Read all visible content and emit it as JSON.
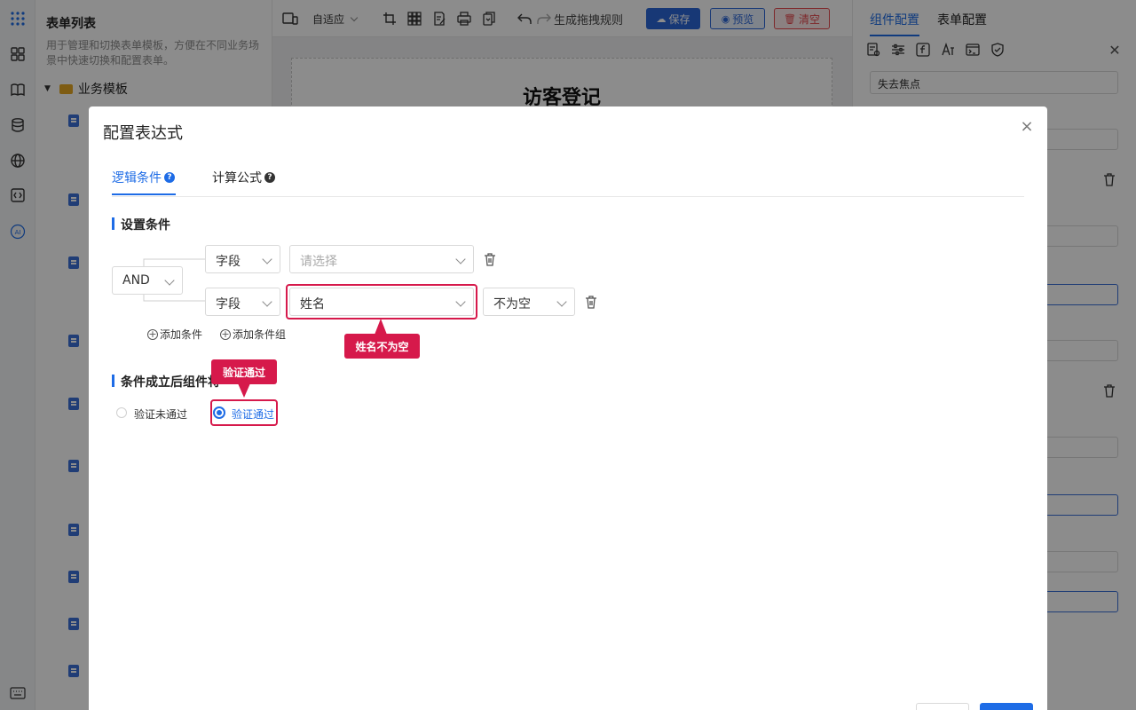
{
  "sidebar_list": {
    "title": "表单列表",
    "description": "用于管理和切换表单模板，方便在不同业务场景中快速切换和配置表单。",
    "folder": "业务模板"
  },
  "toolbar": {
    "fit_label": "自适应",
    "drag_rule_label": "生成拖拽规则",
    "save_label": "保存",
    "preview_label": "预览",
    "clear_label": "清空"
  },
  "canvas": {
    "form_title": "访客登记"
  },
  "right_panel": {
    "tab_component": "组件配置",
    "tab_form": "表单配置",
    "trigger_value": "失去焦点"
  },
  "modal": {
    "title": "配置表达式",
    "tabs": [
      {
        "label": "逻辑条件",
        "active": true
      },
      {
        "label": "计算公式",
        "active": false
      }
    ],
    "section_conditions": "设置条件",
    "logic_operator": "AND",
    "rows": [
      {
        "type": "字段",
        "field_placeholder": "请选择",
        "field_value": ""
      },
      {
        "type": "字段",
        "field_value": "姓名",
        "operator": "不为空"
      }
    ],
    "add_condition": "添加条件",
    "add_group": "添加条件组",
    "section_result": "条件成立后组件将",
    "result_options": [
      {
        "label": "验证未通过",
        "selected": false
      },
      {
        "label": "验证通过",
        "selected": true
      }
    ]
  },
  "annotations": {
    "field_callout": "姓名不为空",
    "radio_callout": "验证通过"
  },
  "colors": {
    "primary": "#1e6ce6",
    "callout": "#d6194b",
    "danger": "#e5484d"
  }
}
